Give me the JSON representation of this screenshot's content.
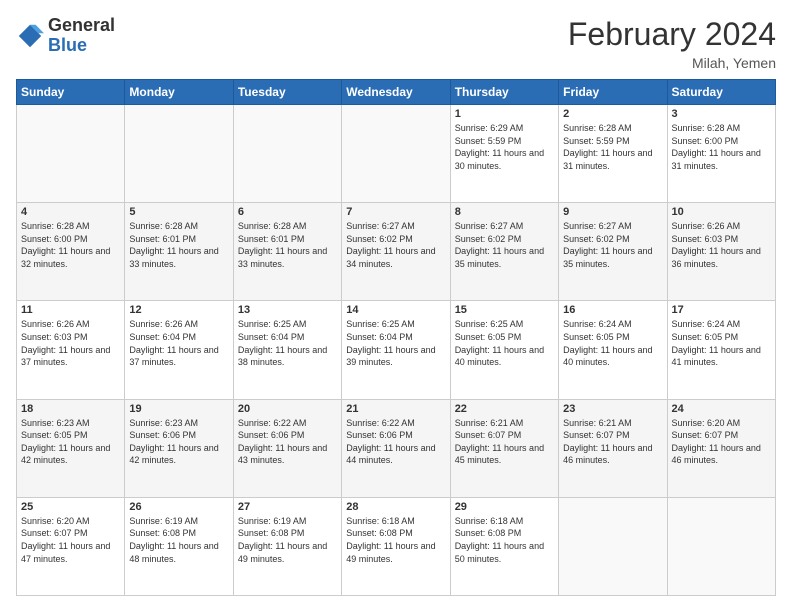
{
  "header": {
    "logo_general": "General",
    "logo_blue": "Blue",
    "month_title": "February 2024",
    "location": "Milah, Yemen"
  },
  "days_of_week": [
    "Sunday",
    "Monday",
    "Tuesday",
    "Wednesday",
    "Thursday",
    "Friday",
    "Saturday"
  ],
  "weeks": [
    [
      {
        "day": "",
        "info": ""
      },
      {
        "day": "",
        "info": ""
      },
      {
        "day": "",
        "info": ""
      },
      {
        "day": "",
        "info": ""
      },
      {
        "day": "1",
        "info": "Sunrise: 6:29 AM\nSunset: 5:59 PM\nDaylight: 11 hours and 30 minutes."
      },
      {
        "day": "2",
        "info": "Sunrise: 6:28 AM\nSunset: 5:59 PM\nDaylight: 11 hours and 31 minutes."
      },
      {
        "day": "3",
        "info": "Sunrise: 6:28 AM\nSunset: 6:00 PM\nDaylight: 11 hours and 31 minutes."
      }
    ],
    [
      {
        "day": "4",
        "info": "Sunrise: 6:28 AM\nSunset: 6:00 PM\nDaylight: 11 hours and 32 minutes."
      },
      {
        "day": "5",
        "info": "Sunrise: 6:28 AM\nSunset: 6:01 PM\nDaylight: 11 hours and 33 minutes."
      },
      {
        "day": "6",
        "info": "Sunrise: 6:28 AM\nSunset: 6:01 PM\nDaylight: 11 hours and 33 minutes."
      },
      {
        "day": "7",
        "info": "Sunrise: 6:27 AM\nSunset: 6:02 PM\nDaylight: 11 hours and 34 minutes."
      },
      {
        "day": "8",
        "info": "Sunrise: 6:27 AM\nSunset: 6:02 PM\nDaylight: 11 hours and 35 minutes."
      },
      {
        "day": "9",
        "info": "Sunrise: 6:27 AM\nSunset: 6:02 PM\nDaylight: 11 hours and 35 minutes."
      },
      {
        "day": "10",
        "info": "Sunrise: 6:26 AM\nSunset: 6:03 PM\nDaylight: 11 hours and 36 minutes."
      }
    ],
    [
      {
        "day": "11",
        "info": "Sunrise: 6:26 AM\nSunset: 6:03 PM\nDaylight: 11 hours and 37 minutes."
      },
      {
        "day": "12",
        "info": "Sunrise: 6:26 AM\nSunset: 6:04 PM\nDaylight: 11 hours and 37 minutes."
      },
      {
        "day": "13",
        "info": "Sunrise: 6:25 AM\nSunset: 6:04 PM\nDaylight: 11 hours and 38 minutes."
      },
      {
        "day": "14",
        "info": "Sunrise: 6:25 AM\nSunset: 6:04 PM\nDaylight: 11 hours and 39 minutes."
      },
      {
        "day": "15",
        "info": "Sunrise: 6:25 AM\nSunset: 6:05 PM\nDaylight: 11 hours and 40 minutes."
      },
      {
        "day": "16",
        "info": "Sunrise: 6:24 AM\nSunset: 6:05 PM\nDaylight: 11 hours and 40 minutes."
      },
      {
        "day": "17",
        "info": "Sunrise: 6:24 AM\nSunset: 6:05 PM\nDaylight: 11 hours and 41 minutes."
      }
    ],
    [
      {
        "day": "18",
        "info": "Sunrise: 6:23 AM\nSunset: 6:05 PM\nDaylight: 11 hours and 42 minutes."
      },
      {
        "day": "19",
        "info": "Sunrise: 6:23 AM\nSunset: 6:06 PM\nDaylight: 11 hours and 42 minutes."
      },
      {
        "day": "20",
        "info": "Sunrise: 6:22 AM\nSunset: 6:06 PM\nDaylight: 11 hours and 43 minutes."
      },
      {
        "day": "21",
        "info": "Sunrise: 6:22 AM\nSunset: 6:06 PM\nDaylight: 11 hours and 44 minutes."
      },
      {
        "day": "22",
        "info": "Sunrise: 6:21 AM\nSunset: 6:07 PM\nDaylight: 11 hours and 45 minutes."
      },
      {
        "day": "23",
        "info": "Sunrise: 6:21 AM\nSunset: 6:07 PM\nDaylight: 11 hours and 46 minutes."
      },
      {
        "day": "24",
        "info": "Sunrise: 6:20 AM\nSunset: 6:07 PM\nDaylight: 11 hours and 46 minutes."
      }
    ],
    [
      {
        "day": "25",
        "info": "Sunrise: 6:20 AM\nSunset: 6:07 PM\nDaylight: 11 hours and 47 minutes."
      },
      {
        "day": "26",
        "info": "Sunrise: 6:19 AM\nSunset: 6:08 PM\nDaylight: 11 hours and 48 minutes."
      },
      {
        "day": "27",
        "info": "Sunrise: 6:19 AM\nSunset: 6:08 PM\nDaylight: 11 hours and 49 minutes."
      },
      {
        "day": "28",
        "info": "Sunrise: 6:18 AM\nSunset: 6:08 PM\nDaylight: 11 hours and 49 minutes."
      },
      {
        "day": "29",
        "info": "Sunrise: 6:18 AM\nSunset: 6:08 PM\nDaylight: 11 hours and 50 minutes."
      },
      {
        "day": "",
        "info": ""
      },
      {
        "day": "",
        "info": ""
      }
    ]
  ]
}
